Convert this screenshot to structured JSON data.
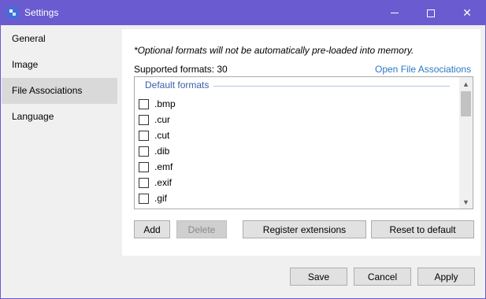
{
  "window": {
    "title": "Settings"
  },
  "sidebar": {
    "items": [
      {
        "label": "General"
      },
      {
        "label": "Image"
      },
      {
        "label": "File Associations"
      },
      {
        "label": "Language"
      }
    ]
  },
  "file_associations": {
    "note": "*Optional formats will not be automatically pre-loaded into memory.",
    "supported_formats": "Supported formats: 30",
    "open_link": "Open File Associations",
    "group_header": "Default formats",
    "formats": [
      {
        "label": ".bmp",
        "checked": false
      },
      {
        "label": ".cur",
        "checked": false
      },
      {
        "label": ".cut",
        "checked": false
      },
      {
        "label": ".dib",
        "checked": false
      },
      {
        "label": ".emf",
        "checked": false
      },
      {
        "label": ".exif",
        "checked": false
      },
      {
        "label": ".gif",
        "checked": false
      }
    ],
    "buttons": {
      "add": "Add",
      "delete": "Delete",
      "register": "Register extensions",
      "reset": "Reset to default"
    }
  },
  "footer": {
    "save": "Save",
    "cancel": "Cancel",
    "apply": "Apply"
  }
}
